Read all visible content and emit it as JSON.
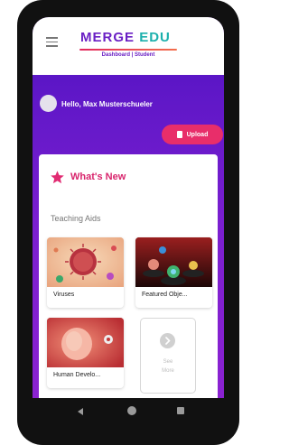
{
  "header": {
    "logo_part1": "MERGE",
    "logo_part2": "EDU",
    "subtitle": "Dashboard | Student",
    "menu_icon": "hamburger-menu-icon"
  },
  "user": {
    "greeting": "Hello, Max Musterschueler",
    "avatar_icon": "avatar"
  },
  "upload": {
    "label": "Upload",
    "icon": "document-icon"
  },
  "whats_new": {
    "title": "What's New",
    "icon": "star-icon",
    "section": "Teaching Aids"
  },
  "tiles": [
    {
      "label": "Viruses"
    },
    {
      "label": "Featured Obje..."
    },
    {
      "label": "Human Develo..."
    }
  ],
  "see_more": {
    "line1": "See",
    "line2": "More",
    "icon": "chevron-right-icon"
  },
  "nav": {
    "back_icon": "back-triangle-icon",
    "home_icon": "home-circle-icon",
    "recent_icon": "recent-square-icon"
  },
  "colors": {
    "brand_purple": "#6a1fc4",
    "brand_teal": "#1cb0ad",
    "accent_pink": "#e82e6a",
    "title_pink": "#d8246c"
  }
}
